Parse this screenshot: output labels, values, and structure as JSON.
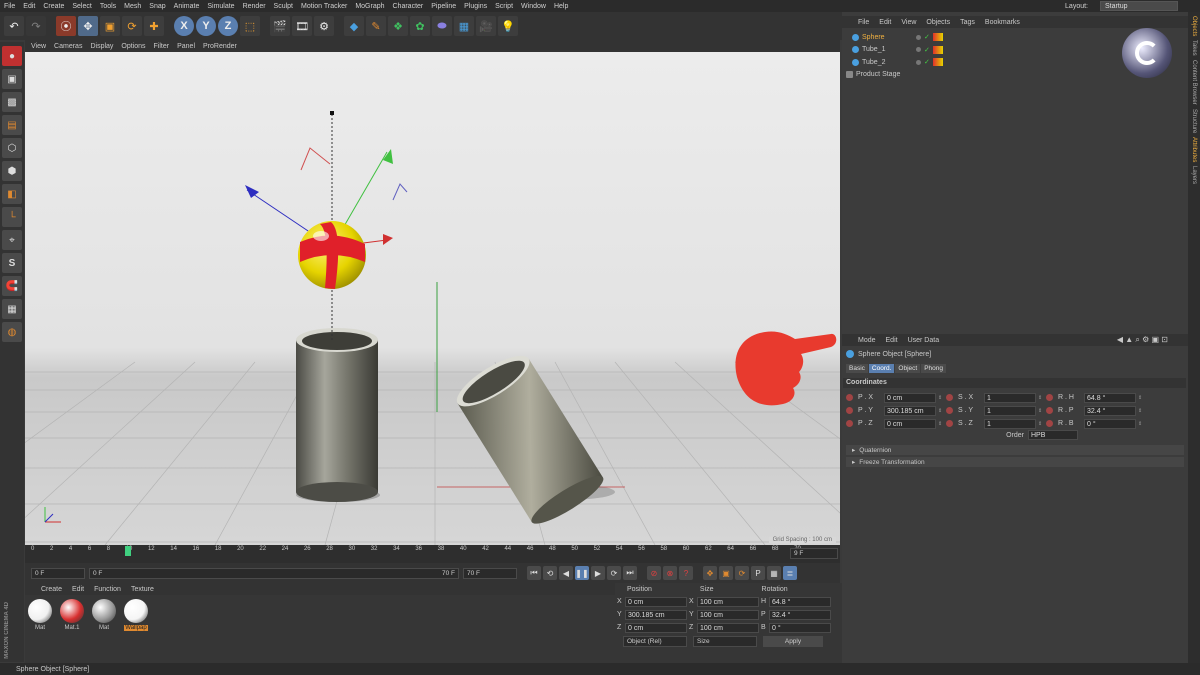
{
  "menubar": {
    "items": [
      "File",
      "Edit",
      "Create",
      "Select",
      "Tools",
      "Mesh",
      "Snap",
      "Animate",
      "Simulate",
      "Render",
      "Sculpt",
      "Motion Tracker",
      "MoGraph",
      "Character",
      "Pipeline",
      "Plugins",
      "Script",
      "Window",
      "Help"
    ],
    "layout_label": "Layout:",
    "layout_value": "Startup"
  },
  "viewport": {
    "menu": [
      "View",
      "Cameras",
      "Display",
      "Options",
      "Filter",
      "Panel",
      "ProRender"
    ],
    "grid_spacing": "Grid Spacing : 100 cm"
  },
  "timeline": {
    "ticks": [
      "0",
      "2",
      "4",
      "6",
      "8",
      "10",
      "12",
      "14",
      "16",
      "18",
      "20",
      "22",
      "24",
      "26",
      "28",
      "30",
      "32",
      "34",
      "36",
      "38",
      "40",
      "42",
      "44",
      "46",
      "48",
      "50",
      "52",
      "54",
      "56",
      "58",
      "60",
      "62",
      "64",
      "66",
      "68",
      "70"
    ],
    "current_frame": "9 F"
  },
  "playback": {
    "start": "0 F",
    "range_start": "0 F",
    "range_end": "70 F",
    "end": "70 F"
  },
  "material_manager": {
    "menu": [
      "Create",
      "Edit",
      "Function",
      "Texture"
    ],
    "materials": [
      {
        "name": "Mat",
        "color": "#f0f0f0"
      },
      {
        "name": "Mat.1",
        "color": "#d83030"
      },
      {
        "name": "Mat",
        "color": "#9a9a9a"
      },
      {
        "name": "Wallpap",
        "color": "#f5f5f5"
      }
    ],
    "logo": "MAXON CINEMA 4D"
  },
  "coord_manager": {
    "headers": [
      "Position",
      "Size",
      "Rotation"
    ],
    "rows": [
      {
        "pl": "X",
        "pv": "0 cm",
        "sl": "X",
        "sv": "100 cm",
        "rl": "H",
        "rv": "64.8 °"
      },
      {
        "pl": "Y",
        "pv": "300.185 cm",
        "sl": "Y",
        "sv": "100 cm",
        "rl": "P",
        "rv": "32.4 °"
      },
      {
        "pl": "Z",
        "pv": "0 cm",
        "sl": "Z",
        "sv": "100 cm",
        "rl": "B",
        "rv": "0 °"
      }
    ],
    "mode": "Object (Rel)",
    "size_mode": "Size",
    "apply": "Apply"
  },
  "object_manager": {
    "menu": [
      "File",
      "Edit",
      "View",
      "Objects",
      "Tags",
      "Bookmarks"
    ],
    "objects": [
      {
        "name": "Sphere",
        "selected": true
      },
      {
        "name": "Tube_1",
        "selected": false
      },
      {
        "name": "Tube_2",
        "selected": false
      },
      {
        "name": "Product Stage",
        "selected": false
      }
    ]
  },
  "attribute_manager": {
    "menu": [
      "Mode",
      "Edit",
      "User Data"
    ],
    "title": "Sphere Object [Sphere]",
    "tabs": [
      "Basic",
      "Coord.",
      "Object",
      "Phong"
    ],
    "active_tab": "Coord.",
    "section": "Coordinates",
    "rows": [
      {
        "p": "P . X",
        "pv": "0 cm",
        "s": "S . X",
        "sv": "1",
        "r": "R . H",
        "rv": "64.8 °"
      },
      {
        "p": "P . Y",
        "pv": "300.185 cm",
        "s": "S . Y",
        "sv": "1",
        "r": "R . P",
        "rv": "32.4 °"
      },
      {
        "p": "P . Z",
        "pv": "0 cm",
        "s": "S . Z",
        "sv": "1",
        "r": "R . B",
        "rv": "0 °"
      }
    ],
    "order_label": "Order",
    "order_value": "HPB",
    "collapsed": [
      "Quaternion",
      "Freeze Transformation"
    ]
  },
  "side_tabs": [
    "Objects",
    "Takes",
    "Content Browser",
    "Structure",
    "Attributes",
    "Layers"
  ],
  "status": "Sphere Object [Sphere]",
  "colors": {
    "accent": "#5a7fb0",
    "selected_text": "#f0b040",
    "pointer": "#e83a2e"
  }
}
